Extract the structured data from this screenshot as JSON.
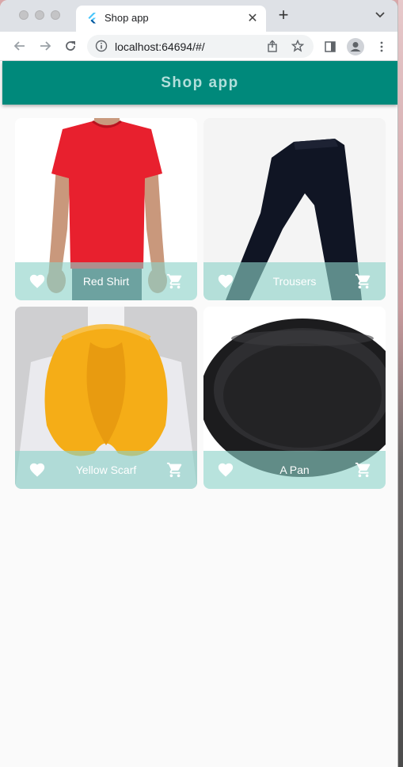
{
  "browser": {
    "tab_title": "Shop app",
    "new_tab": "+",
    "close": "✕",
    "url": "localhost:64694/#/"
  },
  "app": {
    "title": "Shop app",
    "accent": "#00897b",
    "title_color": "#b2dfdb"
  },
  "products": [
    {
      "title": "Red Shirt",
      "image": "red-shirt"
    },
    {
      "title": "Trousers",
      "image": "black-trousers"
    },
    {
      "title": "Yellow Scarf",
      "image": "yellow-scarf"
    },
    {
      "title": "A Pan",
      "image": "cast-iron-pan"
    }
  ]
}
